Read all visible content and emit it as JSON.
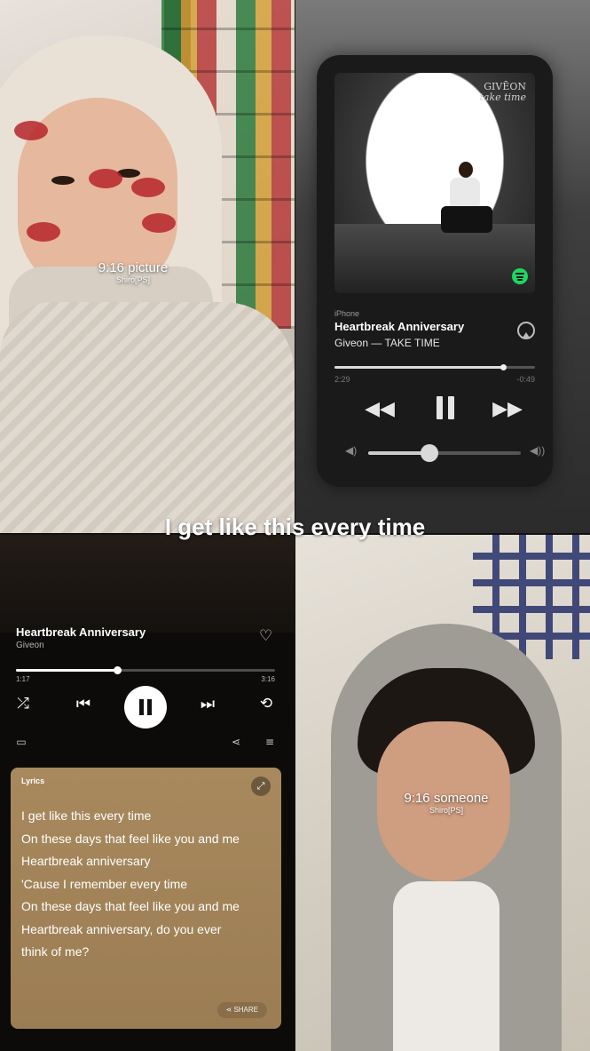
{
  "top_left": {
    "tag_title": "9:16 picture",
    "tag_sub": "Shiro[PS]"
  },
  "player": {
    "album_logo_line1": "GIVĒON",
    "album_logo_line2": "take time",
    "source": "iPhone",
    "title": "Heartbreak Anniversary",
    "artist_album": "Giveon — TAKE TIME",
    "elapsed": "2:29",
    "remaining": "-0:49",
    "progress": 0.84,
    "volume": 0.4,
    "icons": {
      "airplay": "airplay-icon",
      "rewind": "rewind-icon",
      "pause": "pause-icon",
      "fast_forward": "fast-forward-icon",
      "volume_low": "volume-low-icon",
      "volume_high": "volume-high-icon",
      "spotify": "spotify-icon"
    }
  },
  "caption": "I get like this every time",
  "spotify": {
    "title": "Heartbreak Anniversary",
    "artist": "Giveon",
    "elapsed": "1:17",
    "duration": "3:16",
    "progress": 0.39,
    "icons": {
      "heart": "heart-icon",
      "shuffle": "shuffle-icon",
      "previous": "previous-icon",
      "pause": "pause-icon",
      "next": "next-icon",
      "repeat": "repeat-icon",
      "devices": "devices-icon",
      "share": "share-icon",
      "queue": "queue-icon"
    },
    "lyrics": {
      "label": "Lyrics",
      "lines": [
        "I get like this every time",
        "On these days that feel like you and me",
        "Heartbreak anniversary",
        "'Cause I remember every time",
        "On these days that feel like you and me",
        "Heartbreak anniversary, do you ever",
        "think of me?"
      ],
      "share_label": "SHARE",
      "background": "#a8895e"
    },
    "accent": "#1ed760"
  },
  "bottom_right": {
    "tag_title": "9:16 someone",
    "tag_sub": "Shiro[PS]"
  }
}
